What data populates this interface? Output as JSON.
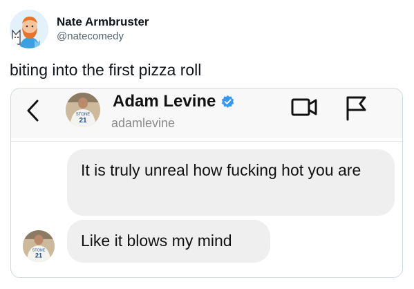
{
  "tweet": {
    "author_name": "Nate Armbruster",
    "author_handle": "@natecomedy",
    "text": "biting into the first pizza roll"
  },
  "dm": {
    "contact_name": "Adam Levine",
    "contact_handle": "adamlevine",
    "verified": true,
    "jersey_label": "STONE",
    "jersey_number": "21",
    "messages": [
      "It is truly unreal how fucking hot you are",
      "Like it blows my mind"
    ]
  },
  "icons": {
    "back": "chevron-left-icon",
    "verified": "verified-badge-icon",
    "video": "video-camera-icon",
    "flag": "flag-icon"
  },
  "colors": {
    "verified_badge": "#3897f0",
    "bubble": "#efefef",
    "handle_gray": "#536471"
  }
}
